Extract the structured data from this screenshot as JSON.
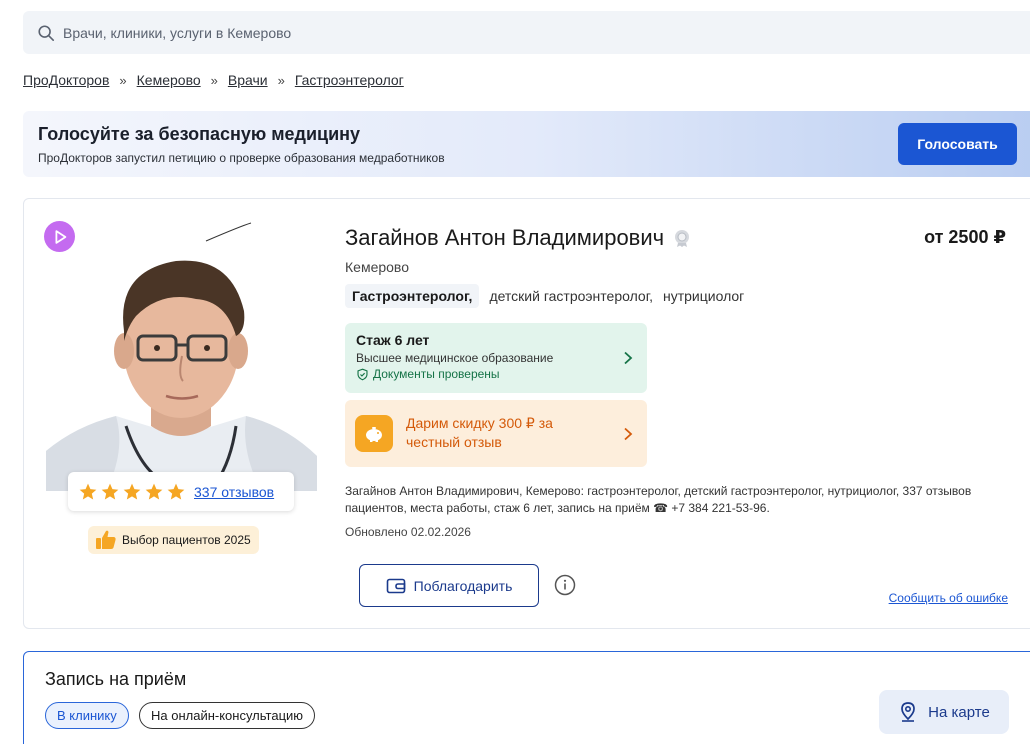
{
  "search": {
    "placeholder": "Врачи, клиники, услуги в Кемерово"
  },
  "breadcrumb": [
    "ПроДокторов",
    "Кемерово",
    "Врачи",
    "Гастроэнтеролог"
  ],
  "breadcrumb_sep": "»",
  "banner": {
    "title": "Голосуйте за безопасную медицину",
    "subtitle": "ПроДокторов запустил петицию о проверке образования медработников",
    "button": "Голосовать"
  },
  "doctor": {
    "name": "Загайнов Антон Владимирович",
    "price": "от 2500 ₽",
    "city": "Кемерово",
    "main_specialty": "Гастроэнтеролог,",
    "specialties": [
      "детский гастроэнтеролог,",
      "нутрициолог"
    ],
    "rating_stars": 5,
    "reviews_link": "337 отзывов",
    "badge": "Выбор пациентов 2025",
    "experience": {
      "title": "Стаж 6 лет",
      "education": "Высшее медицинское образование",
      "verified": "Документы проверены"
    },
    "promo": "Дарим скидку 300 ₽ за честный отзыв",
    "about": "Загайнов Антон Владимирович, Кемерово: гастроэнтеролог, детский гастроэнтеролог, нутрициолог, 337 отзывов пациентов, места работы, стаж 6 лет, запись на приём ☎ +7 384 221-53-96.",
    "updated": "Обновлено 02.02.2026",
    "thank_button": "Поблагодарить",
    "report_link": "Сообщить об ошибке"
  },
  "booking": {
    "title": "Запись на приём",
    "tab_clinic": "В клинику",
    "tab_online": "На онлайн-консультацию",
    "map_button": "На карте"
  },
  "colors": {
    "accent": "#1b56d3",
    "star": "#f5a623",
    "experience_bg": "#e2f4ec",
    "promo_bg": "#fdeedc",
    "promo_text": "#d45a0a"
  },
  "icons": [
    "search-icon",
    "play-icon",
    "star-icon",
    "thumbs-up-icon",
    "medal-icon",
    "shield-check-icon",
    "chevron-right-icon",
    "piggy-bank-icon",
    "wallet-icon",
    "info-icon",
    "map-pin-icon"
  ]
}
